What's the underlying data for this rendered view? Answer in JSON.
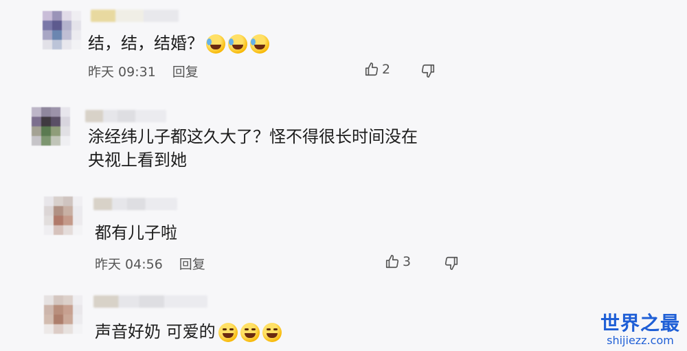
{
  "comments": [
    {
      "text": "结，结，结婚？",
      "emoji_count": 3,
      "emoji_style": "laugh-cry",
      "time": "昨天 09:31",
      "reply_label": "回复",
      "likes": "2"
    },
    {
      "text_line1": "涂经纬儿子都这久大了？怪不得很长时间没在",
      "text_line2": "央视上看到她"
    },
    {
      "text": "都有儿子啦",
      "time": "昨天 04:56",
      "reply_label": "回复",
      "likes": "3"
    },
    {
      "text": "声音好奶 可爱的",
      "emoji_count": 3,
      "emoji_style": "wink-tongue"
    }
  ],
  "watermark": {
    "title": "世界之最",
    "url": "shijiezz.com"
  },
  "colors": {
    "background": "#f7f7f9",
    "meta_text": "#555555",
    "watermark": "#1f5fd6"
  }
}
